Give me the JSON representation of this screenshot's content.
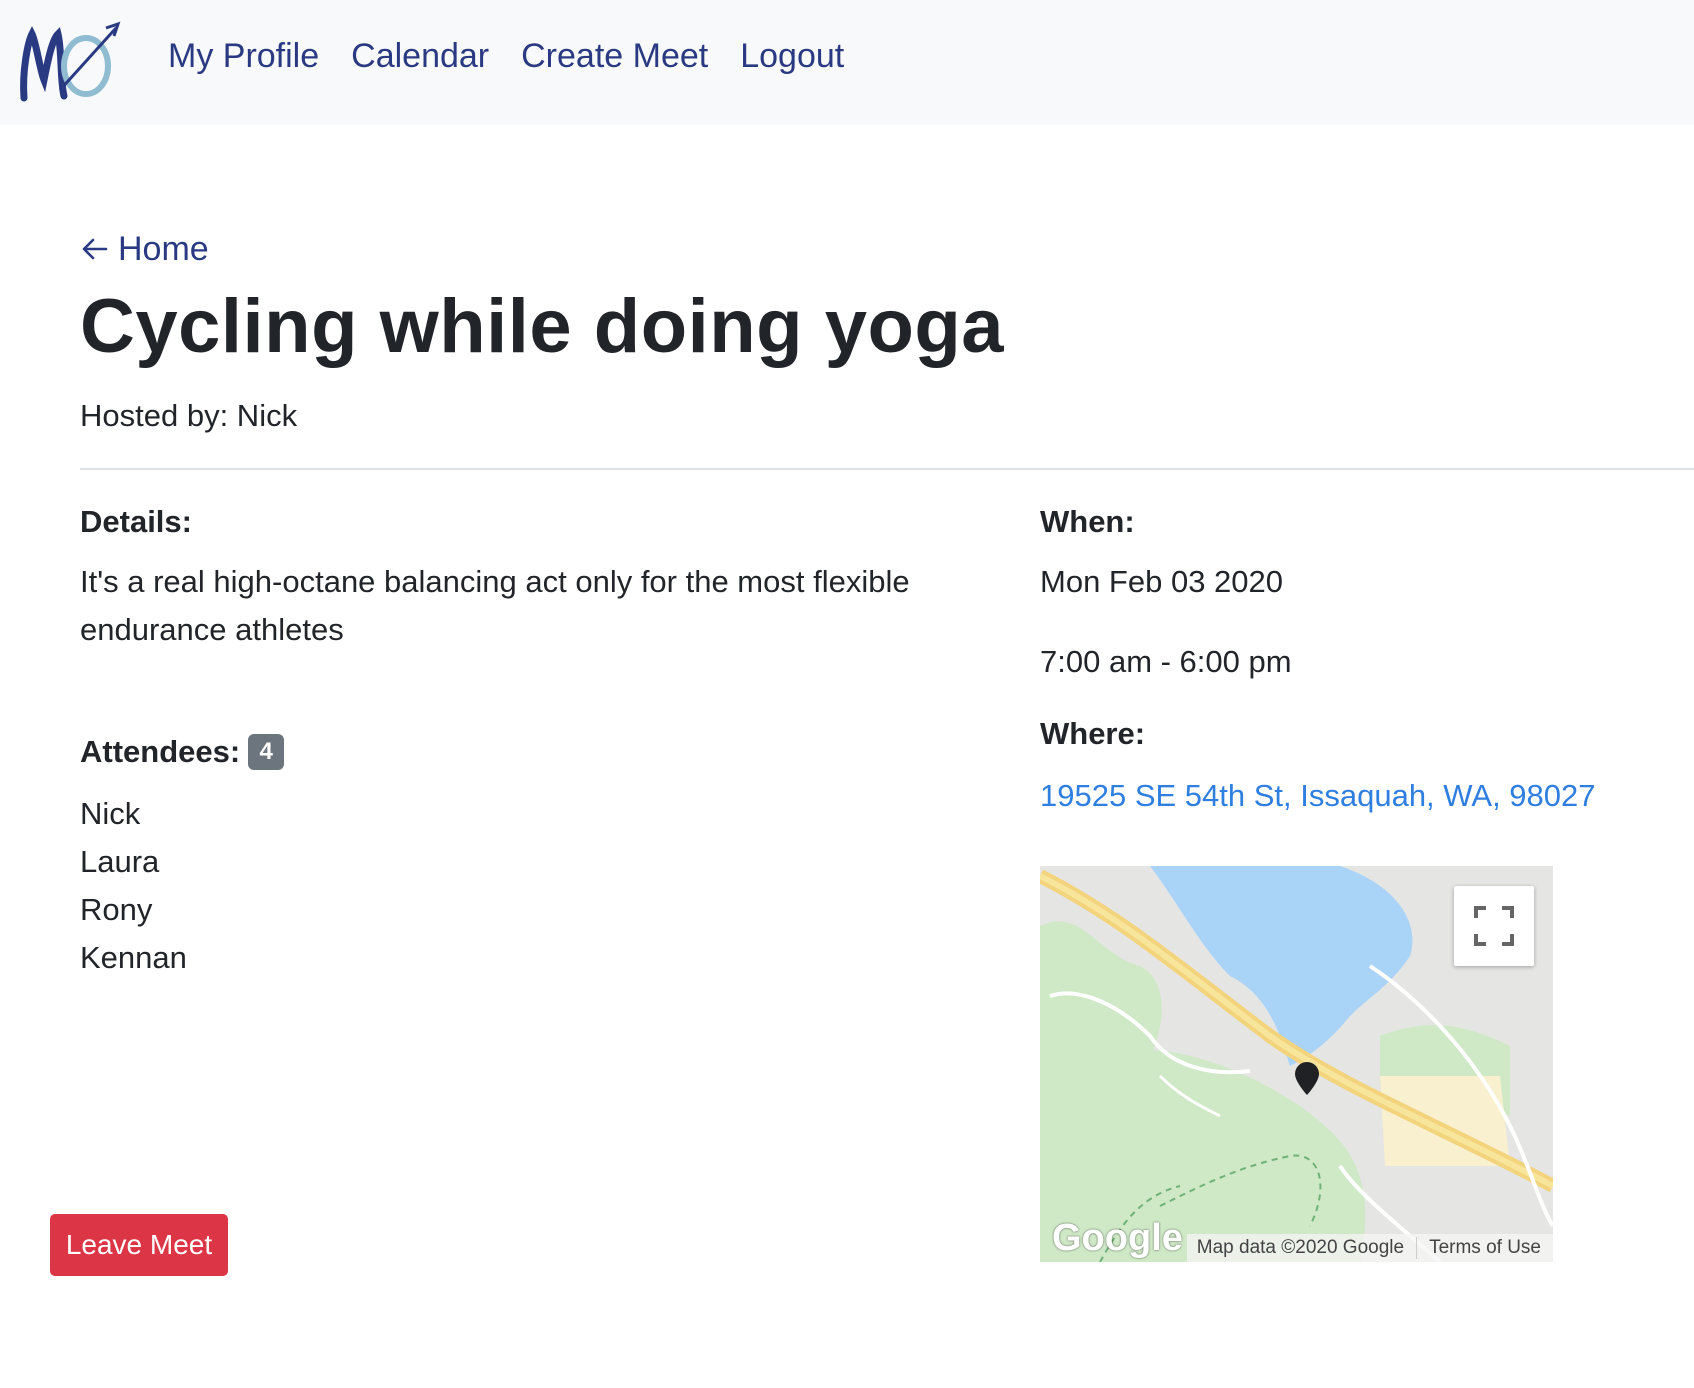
{
  "nav": {
    "links": [
      "My Profile",
      "Calendar",
      "Create Meet",
      "Logout"
    ]
  },
  "back": {
    "label": "Home"
  },
  "meet": {
    "title": "Cycling while doing yoga",
    "hosted_by": "Hosted by: Nick",
    "details_label": "Details:",
    "details_text": "It's a real high-octane balancing act only for the most flexible endurance athletes",
    "attendees_label": "Attendees:",
    "attendee_count": "4",
    "attendees": [
      "Nick",
      "Laura",
      "Rony",
      "Kennan"
    ],
    "leave_button": "Leave Meet",
    "when_label": "When:",
    "date": "Mon Feb 03 2020",
    "time": "7:00 am - 6:00 pm",
    "where_label": "Where:",
    "address": "19525 SE 54th St, Issaquah, WA, 98027"
  },
  "map": {
    "logo": "Google",
    "attribution": "Map data ©2020 Google",
    "terms": "Terms of Use"
  },
  "colors": {
    "navbar_bg": "#f8f9fa",
    "nav_link": "#2a3a82",
    "address_link": "#2f7fe0",
    "danger": "#dc3545",
    "badge": "#6c757d"
  },
  "icons": {
    "logo": "mo-logo-icon",
    "back": "arrow-left-icon",
    "fullscreen": "fullscreen-icon",
    "pin": "map-pin-icon"
  }
}
